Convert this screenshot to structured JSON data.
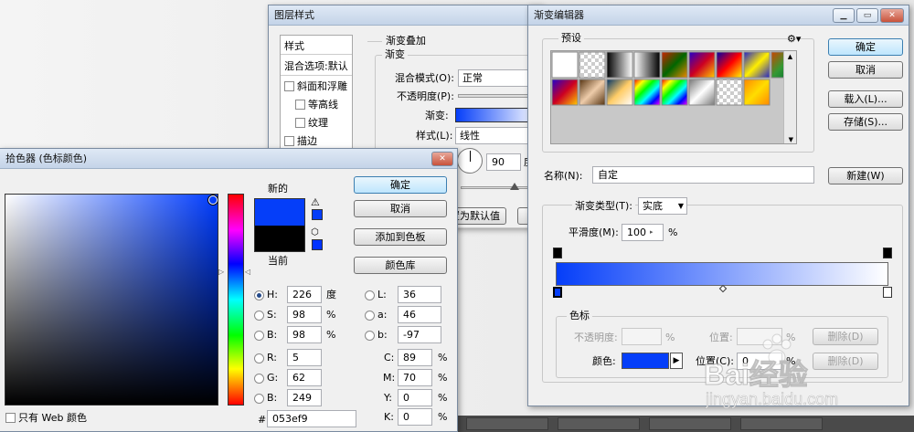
{
  "layer_style": {
    "title": "图层样式",
    "styles_header": "样式",
    "blend_options": "混合选项:默认",
    "items": [
      {
        "label": "斜面和浮雕",
        "checked": false
      },
      {
        "label": "等高线",
        "checked": false
      },
      {
        "label": "纹理",
        "checked": false
      },
      {
        "label": "描边",
        "checked": false
      }
    ],
    "section_title": "渐变叠加",
    "group_title": "渐变",
    "blend_mode_label": "混合模式(O):",
    "blend_mode_value": "正常",
    "opacity_label": "不透明度(P):",
    "gradient_label": "渐变:",
    "style_label": "样式(L):",
    "style_value": "线性",
    "angle_value": "90",
    "angle_unit": "度",
    "default_button": "设置为默认值"
  },
  "gradient_editor": {
    "title": "渐变编辑器",
    "presets_label": "预设",
    "presets_gear_icon": "gear-icon",
    "ok": "确定",
    "cancel": "取消",
    "load": "载入(L)...",
    "save": "存储(S)...",
    "name_label": "名称(N):",
    "name_value": "自定",
    "new_button": "新建(W)",
    "type_label": "渐变类型(T):",
    "type_value": "实底",
    "smooth_label": "平滑度(M):",
    "smooth_value": "100",
    "smooth_unit": "%",
    "stops_group": "色标",
    "opacity_label": "不透明度:",
    "opacity_unit": "%",
    "position_label": "位置:",
    "position_unit": "%",
    "delete_label": "删除(D)",
    "color_label": "颜色:",
    "color_position_label": "位置(C):",
    "color_position_value": "0",
    "color_position_unit": "%",
    "gradient_start_color": "#053ef9",
    "gradient_end_color": "#ffffff"
  },
  "color_picker": {
    "title": "拾色器 (色标颜色)",
    "new_label": "新的",
    "current_label": "当前",
    "new_color": "#053ef9",
    "current_color": "#000000",
    "ok": "确定",
    "cancel": "取消",
    "add_to_swatches": "添加到色板",
    "color_libraries": "颜色库",
    "fields": {
      "H": {
        "label": "H:",
        "value": "226",
        "unit": "度"
      },
      "S": {
        "label": "S:",
        "value": "98",
        "unit": "%"
      },
      "Bv": {
        "label": "B:",
        "value": "98",
        "unit": "%"
      },
      "R": {
        "label": "R:",
        "value": "5"
      },
      "G": {
        "label": "G:",
        "value": "62"
      },
      "B": {
        "label": "B:",
        "value": "249"
      },
      "L": {
        "label": "L:",
        "value": "36"
      },
      "a": {
        "label": "a:",
        "value": "46"
      },
      "b": {
        "label": "b:",
        "value": "-97"
      },
      "C": {
        "label": "C:",
        "value": "89",
        "unit": "%"
      },
      "M": {
        "label": "M:",
        "value": "70",
        "unit": "%"
      },
      "Y": {
        "label": "Y:",
        "value": "0",
        "unit": "%"
      },
      "K": {
        "label": "K:",
        "value": "0",
        "unit": "%"
      }
    },
    "hex_label": "#",
    "hex_value": "053ef9",
    "web_only_label": "只有 Web 颜色"
  },
  "watermark": {
    "brand": "Bai经验",
    "url": "jingyan.baidu.com"
  }
}
